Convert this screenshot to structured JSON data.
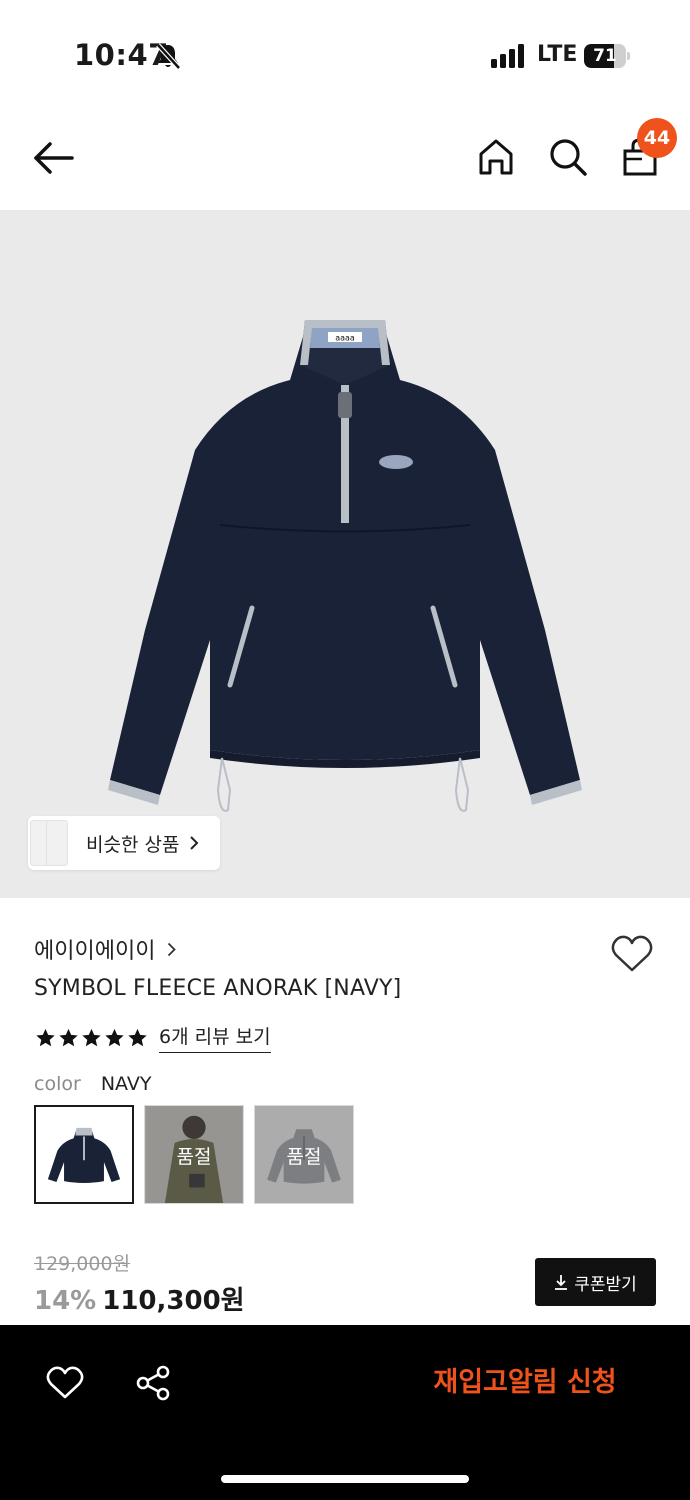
{
  "status_bar": {
    "time": "10:47",
    "network": "LTE",
    "battery_level": "71",
    "battery_fraction": 0.71
  },
  "nav": {
    "cart_count": "44",
    "icons": [
      "back-arrow-icon",
      "home-icon",
      "search-icon",
      "shopping-bag-icon"
    ]
  },
  "hero": {
    "similar_products_label": "비슷한 상품",
    "logo_text": "aaaa"
  },
  "product": {
    "brand": "에이이에이이",
    "title": "SYMBOL FLEECE ANORAK [NAVY]",
    "rating_stars": 5,
    "review_link": "6개 리뷰 보기",
    "color_label": "color",
    "color_value": "NAVY",
    "swatches": [
      {
        "name": "NAVY",
        "sold_out_label": ""
      },
      {
        "name": "KHAKI",
        "sold_out_label": "품절"
      },
      {
        "name": "GRAY",
        "sold_out_label": "품절"
      }
    ],
    "original_price": "129,000원",
    "discount": "14%",
    "final_price": "110,300원",
    "coupon_label": "쿠폰받기"
  },
  "bottom_bar": {
    "restock_label": "재입고알림 신청"
  },
  "colors": {
    "accent": "#f0521b",
    "navy": "#1a2237",
    "hero_bg": "#eaeaea"
  }
}
